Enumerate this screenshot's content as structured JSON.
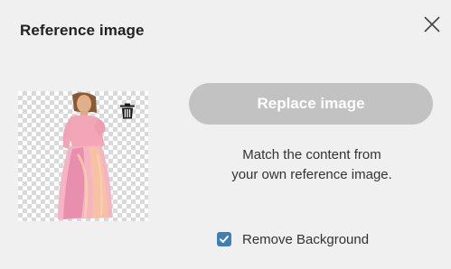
{
  "dialog": {
    "title": "Reference image",
    "close_icon": "close-icon",
    "delete_icon": "trash-icon",
    "replace_button_label": "Replace image",
    "description_line1": "Match the content from",
    "description_line2": "your own reference image.",
    "remove_background": {
      "label": "Remove Background",
      "checked": true
    }
  },
  "colors": {
    "background": "#f0f0f0",
    "button_disabled": "#c2c2c2",
    "checkbox_accent": "#3f7fb5",
    "transparency_checker": "#d9d9d9"
  }
}
